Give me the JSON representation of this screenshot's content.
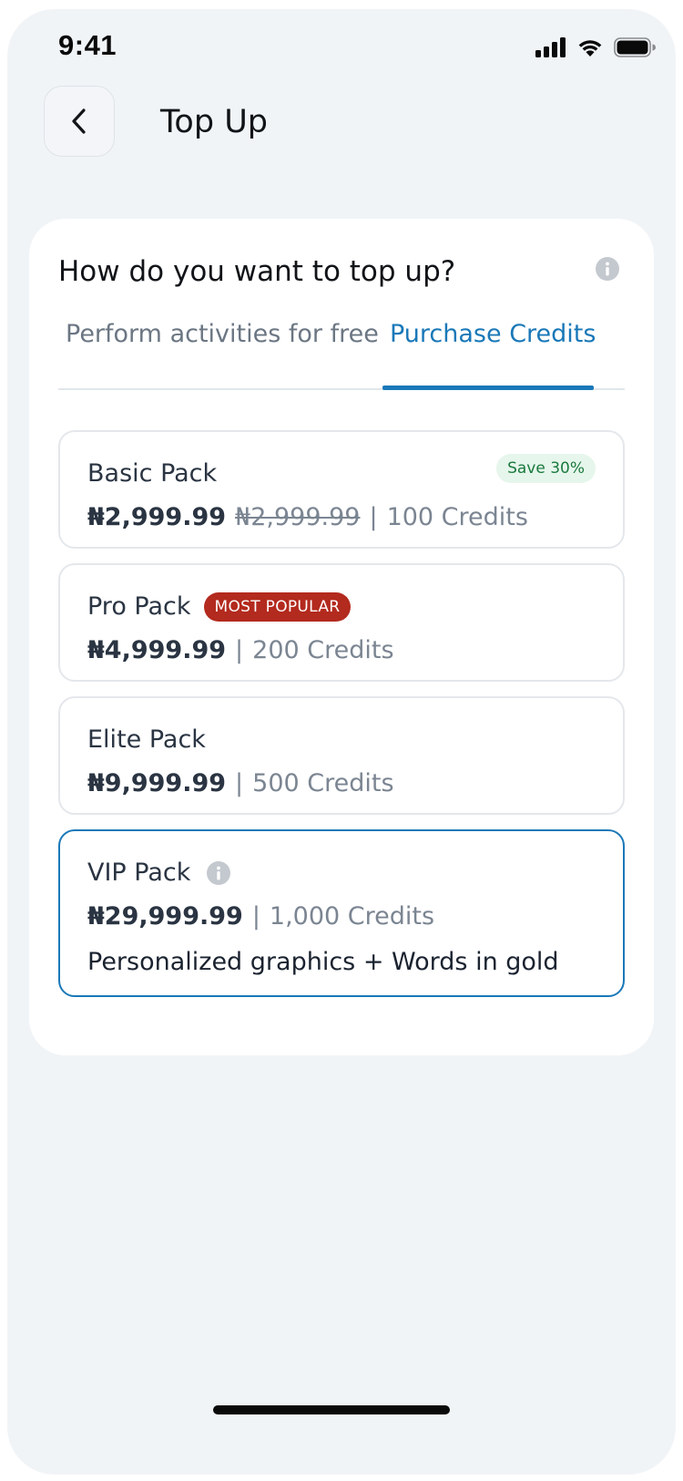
{
  "status_bar": {
    "time": "9:41",
    "icons": [
      "cellular-signal-icon",
      "wifi-icon",
      "battery-icon"
    ]
  },
  "header": {
    "back_icon": "chevron-left-icon",
    "title": "Top Up"
  },
  "card": {
    "question": "How do you want to top up?",
    "info_icon": "info-icon",
    "tabs": [
      {
        "label": "Perform activities for free",
        "active": false
      },
      {
        "label": "Purchase Credits",
        "active": true
      }
    ]
  },
  "packs": [
    {
      "name": "Basic Pack",
      "price": "₦2,999.99",
      "old_price": "₦2,999.99",
      "separator": "|",
      "credits": "100 Credits",
      "badge": "Save 30%"
    },
    {
      "name": "Pro Pack",
      "badge": "MOST POPULAR",
      "price": "₦4,999.99",
      "separator": "|",
      "credits": "200 Credits"
    },
    {
      "name": "Elite Pack",
      "price": "₦9,999.99",
      "separator": "|",
      "credits": "500 Credits"
    },
    {
      "name": "VIP Pack",
      "price": "₦29,999.99",
      "separator": "|",
      "credits": "1,000 Credits",
      "description": "Personalized graphics + Words in gold",
      "selected": true
    }
  ],
  "colors": {
    "accent": "#1a78b8",
    "popular_badge": "#b32a1e",
    "save_badge_bg": "#e6f6ec",
    "save_badge_text": "#1b7a3e",
    "background": "#f1f4f7"
  }
}
